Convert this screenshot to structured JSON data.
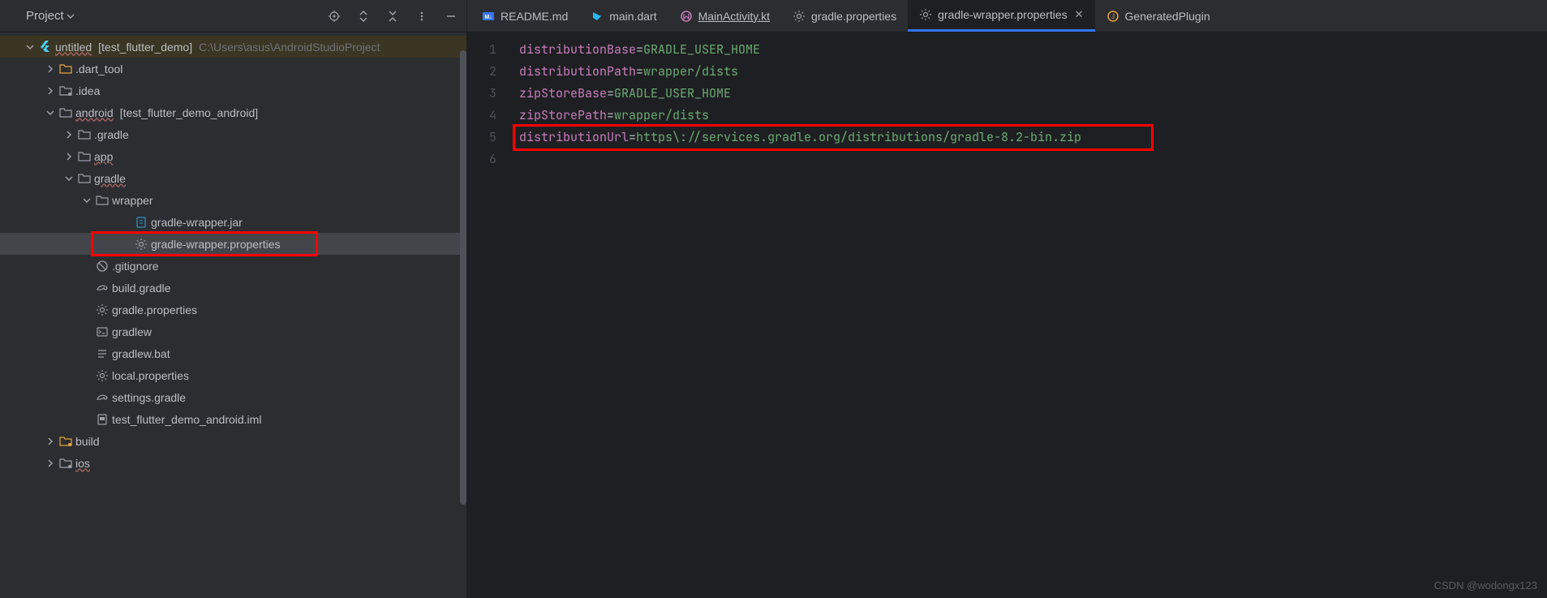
{
  "sidebar": {
    "title": "Project",
    "root": {
      "name": "untitled",
      "suffix": "[test_flutter_demo]",
      "path": "C:\\Users\\asus\\AndroidStudioProject"
    },
    "items": [
      {
        "label": ".dart_tool",
        "type": "folder-orange",
        "indent": 1,
        "chevron": "right"
      },
      {
        "label": ".idea",
        "type": "folder-dotted",
        "indent": 1,
        "chevron": "right"
      },
      {
        "label": "android",
        "suffix": "[test_flutter_demo_android]",
        "type": "folder-open",
        "indent": 1,
        "chevron": "down",
        "underlined": true
      },
      {
        "label": ".gradle",
        "type": "folder-closed",
        "indent": 2,
        "chevron": "right"
      },
      {
        "label": "app",
        "type": "folder-closed",
        "indent": 2,
        "chevron": "right",
        "underlined": true
      },
      {
        "label": "gradle",
        "type": "folder-open",
        "indent": 2,
        "chevron": "down",
        "underlined": true
      },
      {
        "label": "wrapper",
        "type": "folder-open",
        "indent": 3,
        "chevron": "down"
      },
      {
        "label": "gradle-wrapper.jar",
        "type": "jar",
        "indent": 5,
        "chevron": ""
      },
      {
        "label": "gradle-wrapper.properties",
        "type": "gear",
        "indent": 5,
        "chevron": "",
        "selected": true,
        "highlighted": true
      },
      {
        "label": ".gitignore",
        "type": "gitignore",
        "indent": 3,
        "chevron": ""
      },
      {
        "label": "build.gradle",
        "type": "gradle",
        "indent": 3,
        "chevron": ""
      },
      {
        "label": "gradle.properties",
        "type": "gear",
        "indent": 3,
        "chevron": ""
      },
      {
        "label": "gradlew",
        "type": "terminal",
        "indent": 3,
        "chevron": ""
      },
      {
        "label": "gradlew.bat",
        "type": "lines",
        "indent": 3,
        "chevron": ""
      },
      {
        "label": "local.properties",
        "type": "gear",
        "indent": 3,
        "chevron": ""
      },
      {
        "label": "settings.gradle",
        "type": "gradle",
        "indent": 3,
        "chevron": ""
      },
      {
        "label": "test_flutter_demo_android.iml",
        "type": "iml",
        "indent": 3,
        "chevron": ""
      },
      {
        "label": "build",
        "type": "folder-orange-dot",
        "indent": 1,
        "chevron": "right"
      },
      {
        "label": "ios",
        "type": "folder-dotted",
        "indent": 1,
        "chevron": "right",
        "underlined": true
      }
    ]
  },
  "tabs": [
    {
      "label": "README.md",
      "icon": "md",
      "active": false
    },
    {
      "label": "main.dart",
      "icon": "dart",
      "active": false
    },
    {
      "label": "MainActivity.kt",
      "icon": "kotlin",
      "active": false,
      "underlined": true
    },
    {
      "label": "gradle.properties",
      "icon": "gear",
      "active": false
    },
    {
      "label": "gradle-wrapper.properties",
      "icon": "gear",
      "active": true,
      "closable": true
    },
    {
      "label": "GeneratedPlugin",
      "icon": "java",
      "active": false
    }
  ],
  "code": {
    "lines": [
      {
        "key": "distributionBase",
        "val": "GRADLE_USER_HOME"
      },
      {
        "key": "distributionPath",
        "val": "wrapper/dists"
      },
      {
        "key": "zipStoreBase",
        "val": "GRADLE_USER_HOME"
      },
      {
        "key": "zipStorePath",
        "val": "wrapper/dists"
      },
      {
        "key": "distributionUrl",
        "val": "https\\://services.gradle.org/distributions/gradle-8.2-bin.zip",
        "highlighted": true
      }
    ],
    "total_lines": 6
  },
  "watermark": "CSDN @wodongx123"
}
